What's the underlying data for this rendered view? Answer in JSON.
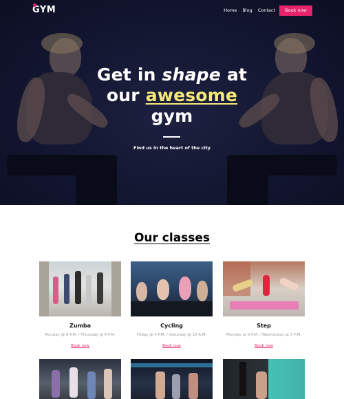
{
  "brand": {
    "logo": "GYM",
    "accent": "#e6246b",
    "highlight": "#f6e978"
  },
  "nav": {
    "links": [
      "Home",
      "Blog",
      "Contact"
    ],
    "cta": "Book now"
  },
  "hero": {
    "line1_a": "Get in ",
    "line1_b": "shape",
    "line1_c": " at",
    "line2_a": "our ",
    "line2_b": "awesome",
    "line3": "gym",
    "tagline": "Find us in the heart of the city"
  },
  "classes": {
    "title": "Our classes",
    "items": [
      {
        "name": "Zumba",
        "schedule": "Monday @ 8 P.M. / Thursday @ 6 P.M.",
        "link": "Book now"
      },
      {
        "name": "Cycling",
        "schedule": "Friday @ 4 P.M. / Saturday @ 10 A.M.",
        "link": "Book now"
      },
      {
        "name": "Step",
        "schedule": "Monday at 6 P.M. / Wednesday at 5 P.M.",
        "link": "Book now"
      }
    ]
  }
}
